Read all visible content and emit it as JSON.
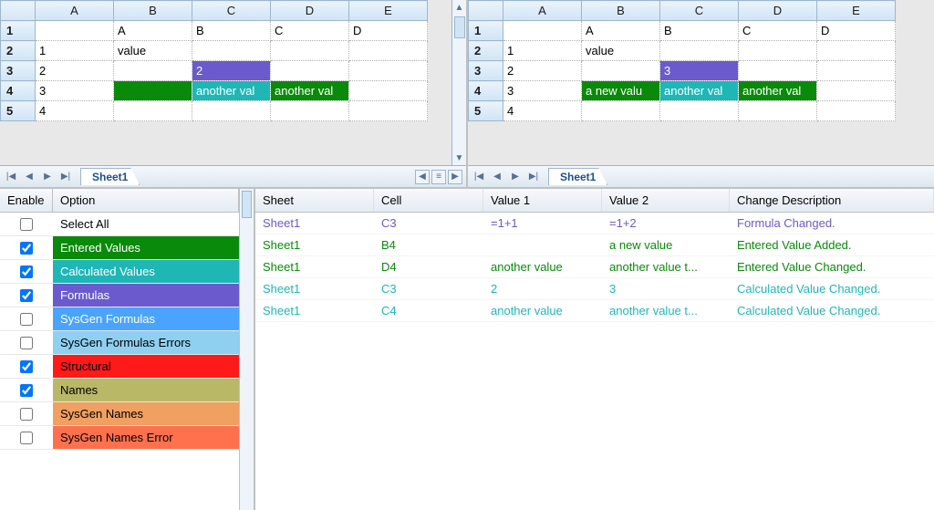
{
  "colors": {
    "enteredValues": "#0a8a0a",
    "calculatedValues": "#1fb6b6",
    "formulas": "#6a5acd",
    "sysgenFormulas": "#4aa3ff",
    "sysgenFormulasErrors": "#8fcff0",
    "structural": "#ff1a1a",
    "names": "#b8b867",
    "sysgenNames": "#f0a060",
    "sysgenNamesError": "#ff704d",
    "selectAllBg": "#ffffff",
    "headerBg": "#eaf3fb"
  },
  "columns": [
    "A",
    "B",
    "C",
    "D",
    "E"
  ],
  "rows": [
    "1",
    "2",
    "3",
    "4",
    "5"
  ],
  "leftSheet": {
    "tab": "Sheet1",
    "cells": {
      "B1": "A",
      "C1": "B",
      "D1": "C",
      "E1": "D",
      "A2": "1",
      "B2": "value",
      "A3": "2",
      "C3": {
        "v": "2",
        "cls": "cell-violet"
      },
      "A4": "3",
      "B4": {
        "v": "",
        "cls": "cell-green"
      },
      "C4": {
        "v": "another val",
        "cls": "cell-teal"
      },
      "D4": {
        "v": "another val",
        "cls": "cell-green"
      },
      "A5": "4"
    }
  },
  "rightSheet": {
    "tab": "Sheet1",
    "cells": {
      "B1": "A",
      "C1": "B",
      "D1": "C",
      "E1": "D",
      "A2": "1",
      "B2": "value",
      "A3": "2",
      "C3": {
        "v": "3",
        "cls": "cell-violet"
      },
      "A4": "3",
      "B4": {
        "v": "a new valu",
        "cls": "cell-green"
      },
      "C4": {
        "v": "another val",
        "cls": "cell-teal"
      },
      "D4": {
        "v": "another val",
        "cls": "cell-green"
      },
      "A5": "4"
    }
  },
  "optionsHeader": {
    "enable": "Enable",
    "option": "Option"
  },
  "options": [
    {
      "label": "Select All",
      "checked": false,
      "bg": "#ffffff",
      "fg": "#000000"
    },
    {
      "label": "Entered Values",
      "checked": true,
      "bg": "#0a8a0a",
      "fg": "#ffffff"
    },
    {
      "label": "Calculated Values",
      "checked": true,
      "bg": "#1fb6b6",
      "fg": "#ffffff"
    },
    {
      "label": "Formulas",
      "checked": true,
      "bg": "#6a5acd",
      "fg": "#ffffff"
    },
    {
      "label": "SysGen Formulas",
      "checked": false,
      "bg": "#4aa3ff",
      "fg": "#ffffff"
    },
    {
      "label": "SysGen Formulas Errors",
      "checked": false,
      "bg": "#8fcff0",
      "fg": "#000000"
    },
    {
      "label": "Structural",
      "checked": true,
      "bg": "#ff1a1a",
      "fg": "#000000"
    },
    {
      "label": "Names",
      "checked": true,
      "bg": "#b8b867",
      "fg": "#000000"
    },
    {
      "label": "SysGen Names",
      "checked": false,
      "bg": "#f0a060",
      "fg": "#000000"
    },
    {
      "label": "SysGen Names Error",
      "checked": false,
      "bg": "#ff704d",
      "fg": "#000000"
    }
  ],
  "diffHeader": {
    "sheet": "Sheet",
    "cell": "Cell",
    "v1": "Value 1",
    "v2": "Value 2",
    "desc": "Change Description"
  },
  "diffs": [
    {
      "sheet": "Sheet1",
      "cell": "C3",
      "v1": "=1+1",
      "v2": "=1+2",
      "desc": "Formula Changed.",
      "cls": "c-violet"
    },
    {
      "sheet": "Sheet1",
      "cell": "B4",
      "v1": "",
      "v2": "a new value",
      "desc": "Entered Value Added.",
      "cls": "c-green"
    },
    {
      "sheet": "Sheet1",
      "cell": "D4",
      "v1": "another value",
      "v2": "another value t...",
      "desc": "Entered Value Changed.",
      "cls": "c-green"
    },
    {
      "sheet": "Sheet1",
      "cell": "C3",
      "v1": "2",
      "v2": "3",
      "desc": "Calculated Value Changed.",
      "cls": "c-teal"
    },
    {
      "sheet": "Sheet1",
      "cell": "C4",
      "v1": "another value",
      "v2": "another value t...",
      "desc": "Calculated Value Changed.",
      "cls": "c-teal"
    }
  ],
  "icons": {
    "first": "|◀",
    "prev": "◀",
    "next": "▶",
    "last": "▶|",
    "hbar": "≡",
    "up": "▲",
    "down": "▼"
  }
}
